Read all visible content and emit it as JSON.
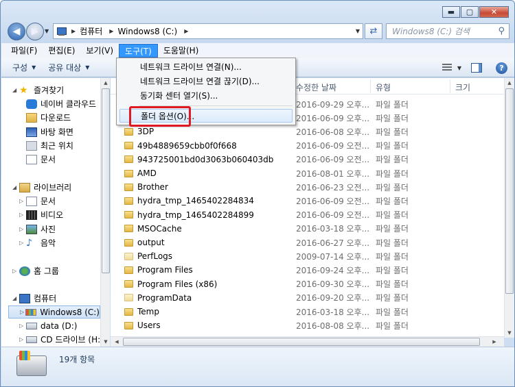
{
  "window": {
    "minimize": "▬",
    "maximize": "▢",
    "close": "✕"
  },
  "address": {
    "crumbs": [
      "컴퓨터",
      "Windows8 (C:)"
    ],
    "search_placeholder": "Windows8 (C:) 검색"
  },
  "menubar": {
    "items": [
      "파일(F)",
      "편집(E)",
      "보기(V)",
      "도구(T)",
      "도움말(H)"
    ],
    "active": "도구(T)"
  },
  "toolbar": {
    "organize": "구성",
    "share": "공유 대상"
  },
  "tools_menu": {
    "items": [
      "네트워크 드라이브 연결(N)...",
      "네트워크 드라이브 연결 끊기(D)...",
      "동기화 센터 열기(S)...",
      "폴더 옵션(O)..."
    ],
    "highlighted": "폴더 옵션(O)..."
  },
  "navpane": {
    "favorites": "즐겨찾기",
    "fav_items": [
      "네이버 클라우드",
      "다운로드",
      "바탕 화면",
      "최근 위치",
      "문서"
    ],
    "libraries": "라이브러리",
    "lib_items": [
      "문서",
      "비디오",
      "사진",
      "음악"
    ],
    "homegroup": "홈 그룹",
    "computer": "컴퓨터",
    "drives": [
      "Windows8 (C:)",
      "data (D:)",
      "CD 드라이브 (H:)"
    ]
  },
  "columns": {
    "date": "수정한 날짜",
    "type": "유형",
    "size": "크기"
  },
  "files": [
    {
      "name": "",
      "date": "2016-09-29 오후...",
      "type": "파일 폴더"
    },
    {
      "name": "",
      "date": "2016-06-09 오후...",
      "type": "파일 폴더"
    },
    {
      "name": "3DP",
      "date": "2016-06-08 오후...",
      "type": "파일 폴더"
    },
    {
      "name": "49b4889659cbb0f0f668",
      "date": "2016-06-09 오전...",
      "type": "파일 폴더"
    },
    {
      "name": "943725001bd0d3063b060403db",
      "date": "2016-06-09 오전...",
      "type": "파일 폴더"
    },
    {
      "name": "AMD",
      "date": "2016-08-01 오후...",
      "type": "파일 폴더"
    },
    {
      "name": "Brother",
      "date": "2016-06-23 오전...",
      "type": "파일 폴더"
    },
    {
      "name": "hydra_tmp_1465402284834",
      "date": "2016-06-09 오전...",
      "type": "파일 폴더"
    },
    {
      "name": "hydra_tmp_1465402284899",
      "date": "2016-06-09 오전...",
      "type": "파일 폴더"
    },
    {
      "name": "MSOCache",
      "date": "2016-03-18 오후...",
      "type": "파일 폴더"
    },
    {
      "name": "output",
      "date": "2016-06-27 오후...",
      "type": "파일 폴더"
    },
    {
      "name": "PerfLogs",
      "date": "2009-07-14 오후...",
      "type": "파일 폴더"
    },
    {
      "name": "Program Files",
      "date": "2016-09-24 오후...",
      "type": "파일 폴더"
    },
    {
      "name": "Program Files (x86)",
      "date": "2016-09-30 오후...",
      "type": "파일 폴더"
    },
    {
      "name": "ProgramData",
      "date": "2016-09-20 오후...",
      "type": "파일 폴더"
    },
    {
      "name": "Temp",
      "date": "2016-03-18 오후...",
      "type": "파일 폴더"
    },
    {
      "name": "Users",
      "date": "2016-08-08 오후...",
      "type": "파일 폴더"
    }
  ],
  "status": {
    "count": "19개 항목"
  }
}
